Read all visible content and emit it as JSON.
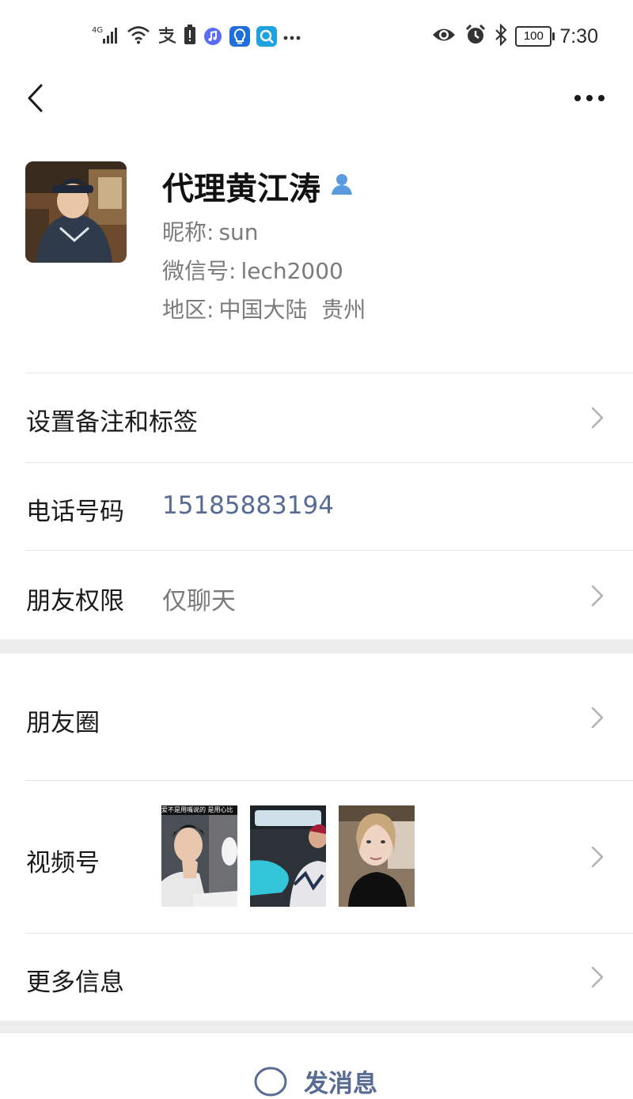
{
  "status_bar": {
    "network": "4G",
    "battery": "100",
    "time": "7:30"
  },
  "profile": {
    "name": "代理黄江涛",
    "nickname_label": "昵称:",
    "nickname": "sun",
    "wechat_id_label": "微信号:",
    "wechat_id": "lech2000",
    "region_label": "地区:",
    "region": "中国大陆  贵州"
  },
  "rows": {
    "remark": {
      "label": "设置备注和标签"
    },
    "phone": {
      "label": "电话号码",
      "value": "15185883194"
    },
    "permission": {
      "label": "朋友权限",
      "value": "仅聊天"
    },
    "moments": {
      "label": "朋友圈"
    },
    "channels": {
      "label": "视频号",
      "thumb1_caption": "爱不是用嘴说的 是用心比"
    },
    "more_info": {
      "label": "更多信息"
    }
  },
  "send_message": {
    "label": "发消息"
  },
  "colors": {
    "link": "#576b95",
    "secondary_text": "#7b7b7b",
    "divider": "#e6e6e6",
    "section_gap": "#ededed",
    "verified_icon": "#5a9be0"
  }
}
